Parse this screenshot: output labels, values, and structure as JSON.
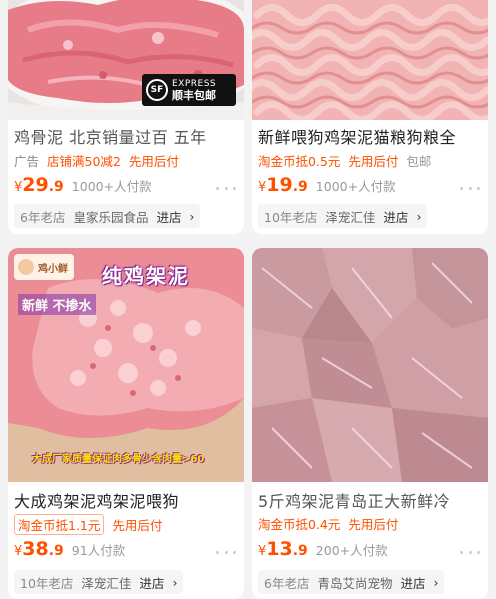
{
  "products": [
    {
      "title": "鸡骨泥 北京销量过百 五年",
      "tags": [
        "广告",
        "店铺满50减2",
        "先用后付"
      ],
      "price_int": "29",
      "price_dec": ".9",
      "currency": "¥",
      "sold": "1000+人付款",
      "store_age": "6年老店",
      "store_name": "皇家乐园食品",
      "enter_label": "进店",
      "badge_top": "EXPRESS",
      "badge_bottom": "顺丰包邮",
      "badge_logo": "SF"
    },
    {
      "title": "新鲜喂狗鸡架泥猫粮狗粮全",
      "tags": [
        "淘金币抵0.5元",
        "先用后付",
        "包邮"
      ],
      "price_int": "19",
      "price_dec": ".9",
      "currency": "¥",
      "sold": "1000+人付款",
      "store_age": "10年老店",
      "store_name": "泽宠汇佳",
      "enter_label": "进店"
    },
    {
      "title": "大成鸡架泥鸡架泥喂狗",
      "tags": [
        "淘金币抵1.1元",
        "先用后付"
      ],
      "price_int": "38",
      "price_dec": ".9",
      "currency": "¥",
      "sold": "91人付款",
      "store_age": "10年老店",
      "store_name": "泽宠汇佳",
      "enter_label": "进店",
      "img_title": "纯鸡架泥",
      "img_sub": "新鲜 不掺水",
      "img_caption": "大成厂家质量保证肉多骨少含肉量>60",
      "img_logo": "鸡小鲜"
    },
    {
      "title": "5斤鸡架泥青岛正大新鲜冷",
      "tags": [
        "淘金币抵0.4元",
        "先用后付"
      ],
      "price_int": "13",
      "price_dec": ".9",
      "currency": "¥",
      "sold": "200+人付款",
      "store_age": "6年老店",
      "store_name": "青岛艾尚宠物",
      "enter_label": "进店"
    }
  ],
  "icons": {
    "more": "more-dots-icon",
    "chevron": "chevron-right-icon"
  },
  "colors": {
    "accent": "#ff5000",
    "meat": "#e98a96"
  }
}
